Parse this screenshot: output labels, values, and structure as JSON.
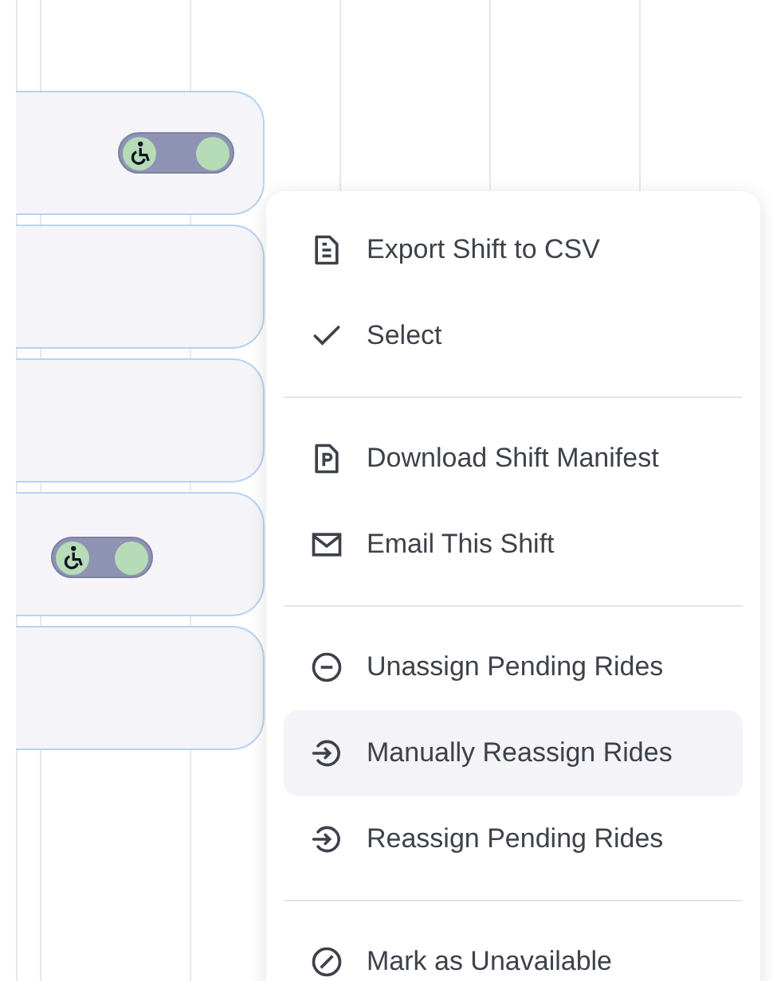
{
  "shift_cards": [
    {
      "wheelchair_badge": true
    },
    {
      "wheelchair_badge": false
    },
    {
      "wheelchair_badge": false
    },
    {
      "wheelchair_badge": true
    },
    {
      "wheelchair_badge": false
    }
  ],
  "context_menu": {
    "groups": [
      {
        "items": [
          {
            "kind": "document",
            "label": "Export Shift to CSV",
            "selected": false
          },
          {
            "kind": "check",
            "label": "Select",
            "selected": false
          }
        ]
      },
      {
        "items": [
          {
            "kind": "manifest",
            "label": "Download Shift Manifest",
            "selected": false
          },
          {
            "kind": "mail",
            "label": "Email This Shift",
            "selected": false
          }
        ]
      },
      {
        "items": [
          {
            "kind": "unassign",
            "label": "Unassign Pending Rides",
            "selected": false
          },
          {
            "kind": "reassign",
            "label": "Manually Reassign Rides",
            "selected": true
          },
          {
            "kind": "reassign",
            "label": "Reassign Pending Rides",
            "selected": false
          }
        ]
      },
      {
        "items": [
          {
            "kind": "unavailable",
            "label": "Mark as Unavailable",
            "selected": false
          }
        ]
      }
    ]
  }
}
